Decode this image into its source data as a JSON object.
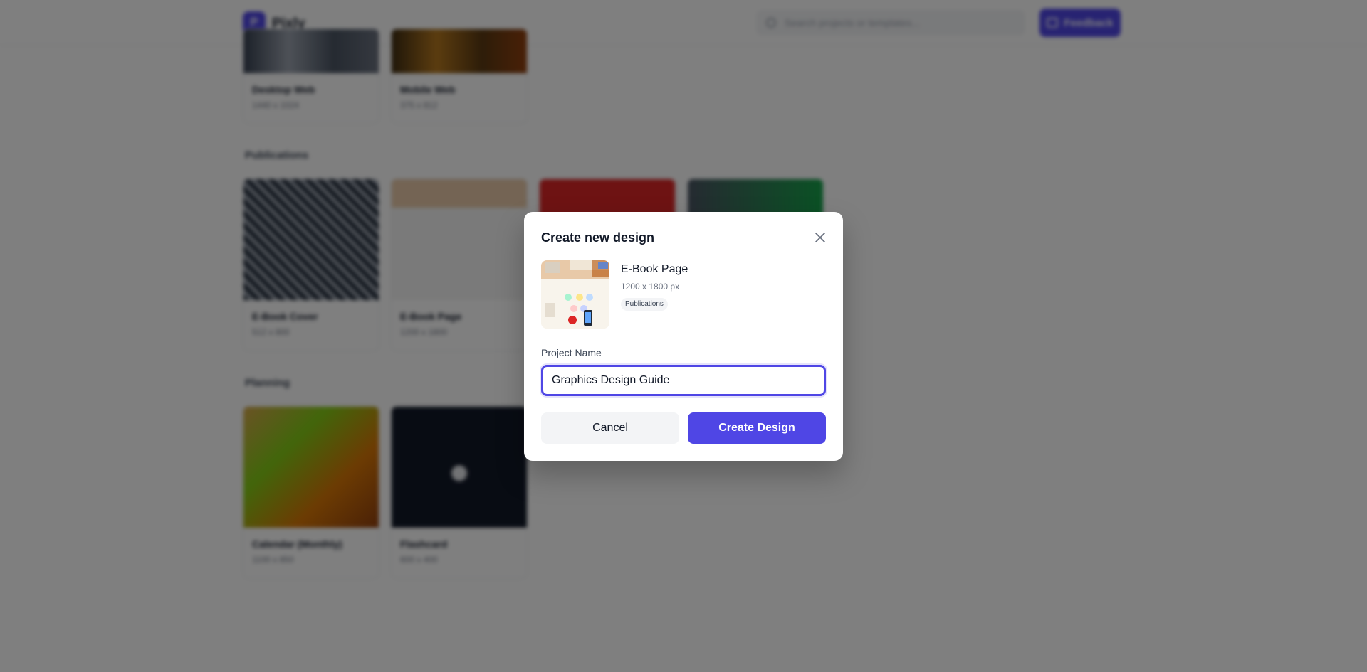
{
  "app": {
    "logo_letter": "P",
    "name": "Pixly"
  },
  "header": {
    "search_placeholder": "Search projects or templates...",
    "feedback_label": "Feedback"
  },
  "sections": {
    "web": {
      "cards": [
        {
          "name": "Desktop Web",
          "size": "1440 x 1024"
        },
        {
          "name": "Mobile Web",
          "size": "375 x 812"
        }
      ]
    },
    "publications": {
      "title": "Publications",
      "cards": [
        {
          "name": "E-Book Cover",
          "size": "512 x 800"
        },
        {
          "name": "E-Book Page",
          "size": "1200 x 1800"
        }
      ]
    },
    "planning": {
      "title": "Planning",
      "cards": [
        {
          "name": "Calendar (Monthly)",
          "size": "1100 x 850"
        },
        {
          "name": "Flashcard",
          "size": "600 x 400"
        }
      ]
    }
  },
  "modal": {
    "title": "Create new design",
    "template": {
      "name": "E-Book Page",
      "size": "1200 x 1800 px",
      "category": "Publications"
    },
    "project_name_label": "Project Name",
    "project_name_value": "Graphics Design Guide",
    "cancel_label": "Cancel",
    "create_label": "Create Design"
  },
  "colors": {
    "accent": "#4f46e5",
    "overlay": "rgba(0,0,0,0.5)"
  }
}
